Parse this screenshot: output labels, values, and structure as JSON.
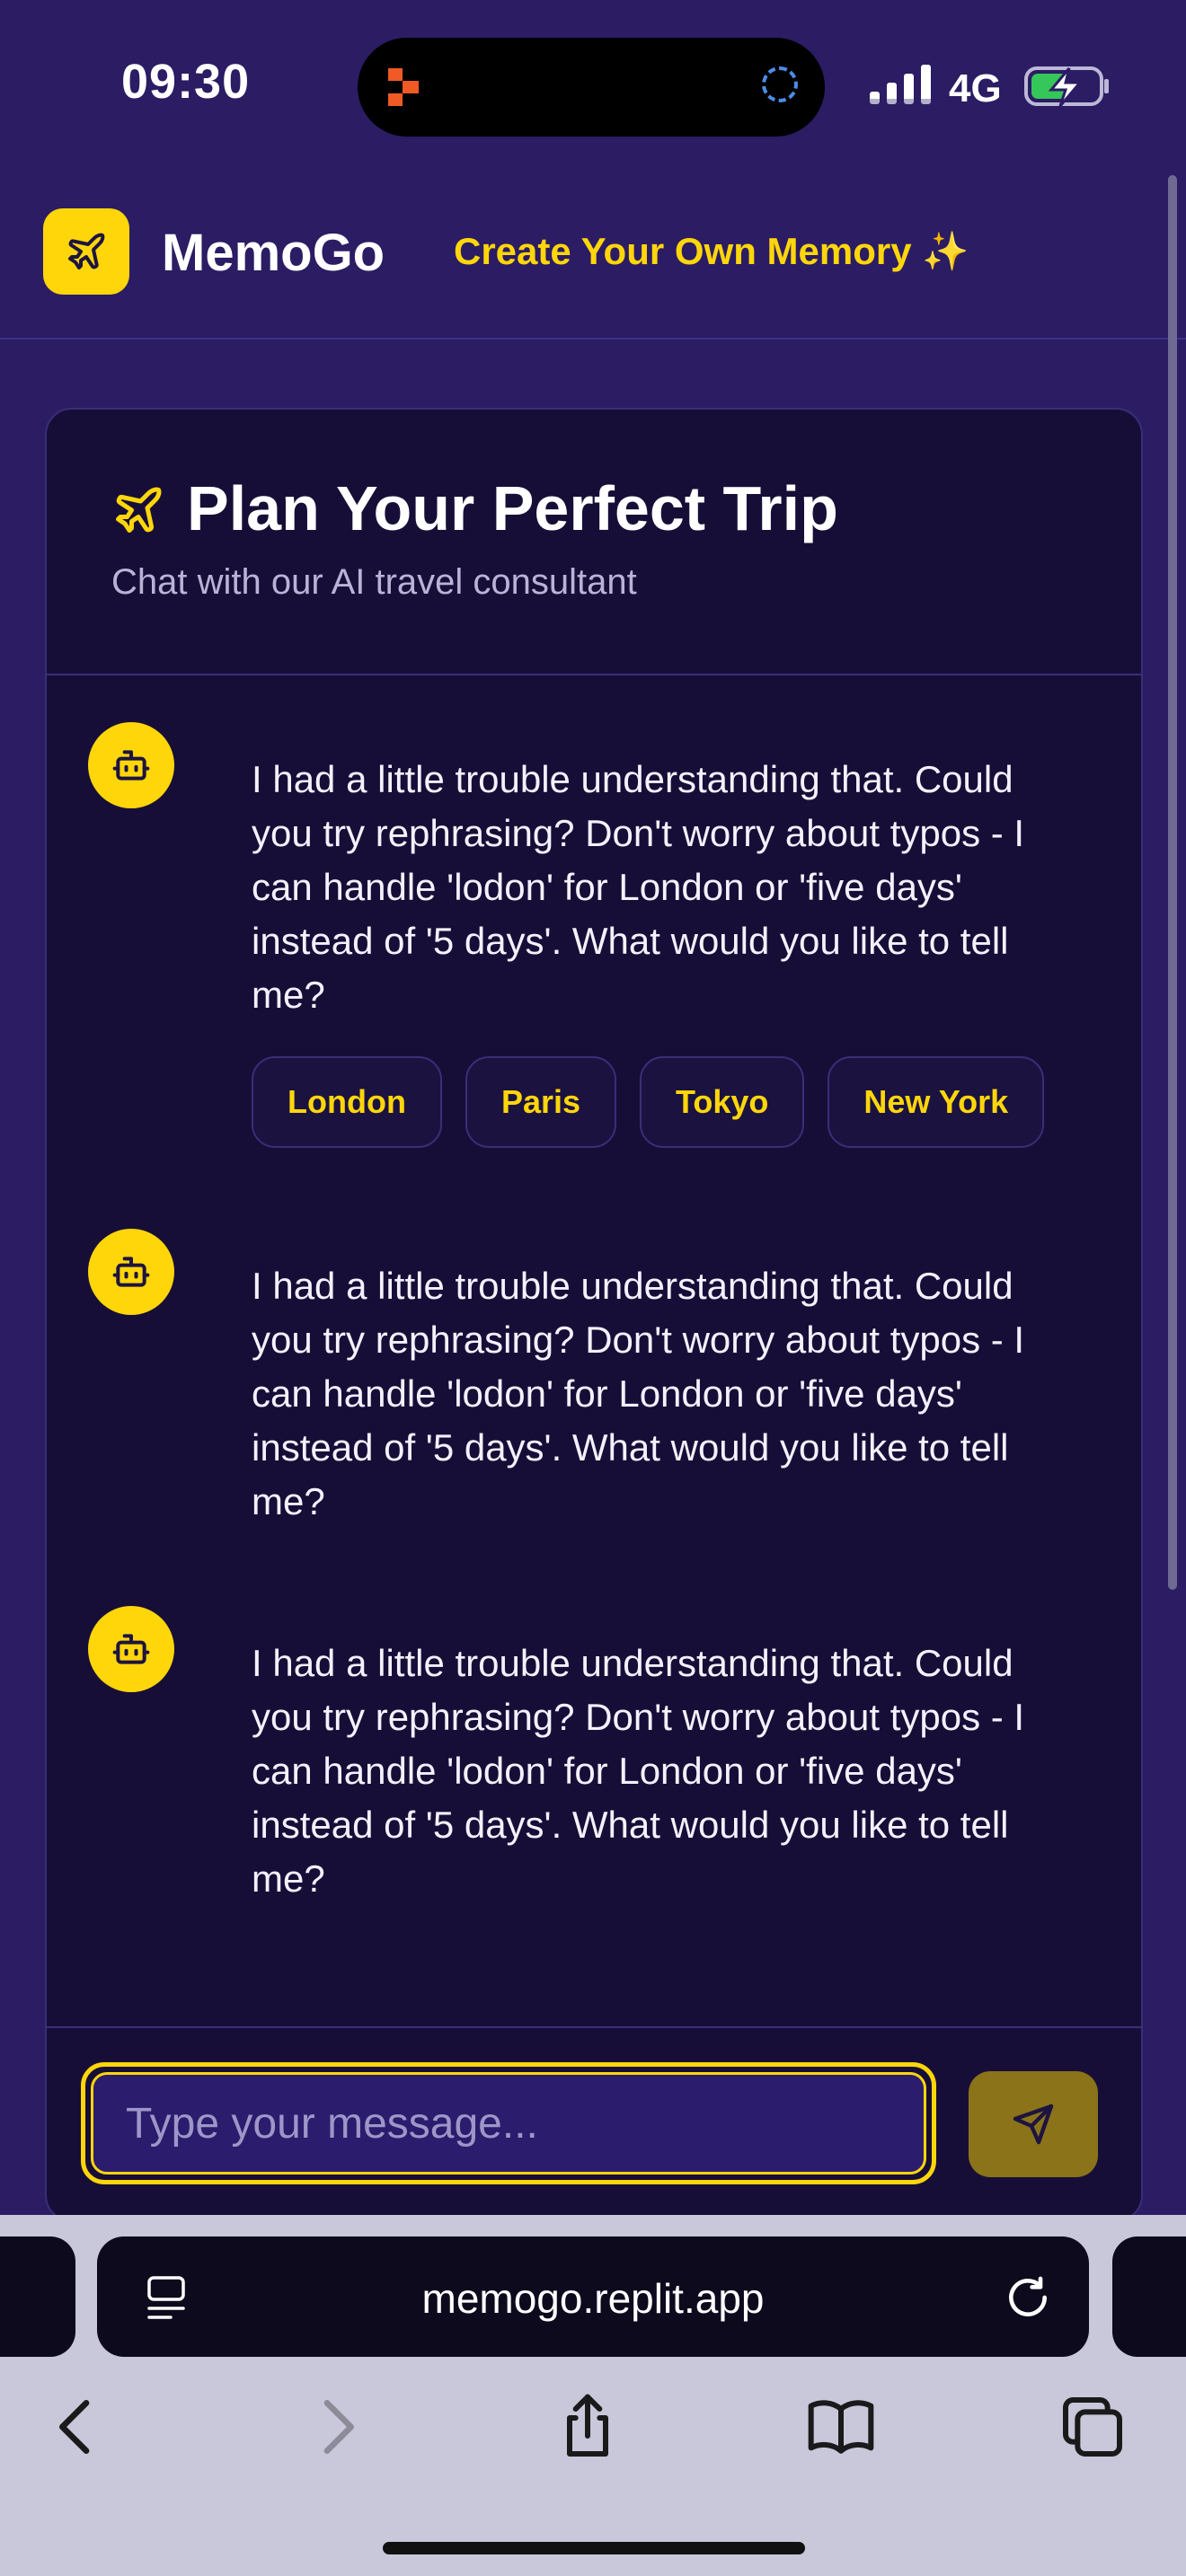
{
  "status_bar": {
    "time": "09:30",
    "network": "4G",
    "icons": [
      "app-activity-icon",
      "loading-spinner-icon",
      "signal-icon",
      "battery-charging-icon"
    ]
  },
  "header": {
    "brand": "MemoGo",
    "logo_icon": "airplane-icon",
    "create_link": "Create Your Own Memory ✨",
    "brand_color": "#ffd60a"
  },
  "chat": {
    "title": "Plan Your Perfect Trip",
    "title_icon": "airplane-icon",
    "subtitle": "Chat with our AI travel consultant",
    "messages": [
      {
        "sender_icon": "bot-icon",
        "text": "I had a little trouble understanding that. Could you try rephrasing? Don't worry about typos - I can handle 'lodon' for London or 'five days' instead of '5 days'. What would you like to tell me?",
        "quick_replies": [
          "London",
          "Paris",
          "Tokyo",
          "New York"
        ]
      },
      {
        "sender_icon": "bot-icon",
        "text": "I had a little trouble understanding that. Could you try rephrasing? Don't worry about typos - I can handle 'lodon' for London or 'five days' instead of '5 days'. What would you like to tell me?"
      },
      {
        "sender_icon": "bot-icon",
        "text": "I had a little trouble understanding that. Could you try rephrasing? Don't worry about typos - I can handle 'lodon' for London or 'five days' instead of '5 days'. What would you like to tell me?"
      }
    ],
    "input": {
      "placeholder": "Type your message...",
      "value": ""
    },
    "send_icon": "send-icon"
  },
  "browser": {
    "url": "memogo.replit.app",
    "toolbar_icons": [
      "back-icon",
      "forward-icon",
      "share-icon",
      "bookmarks-icon",
      "tabs-icon"
    ]
  },
  "colors": {
    "background": "#2b1c64",
    "card": "#170e38",
    "accent": "#ffd60a"
  }
}
